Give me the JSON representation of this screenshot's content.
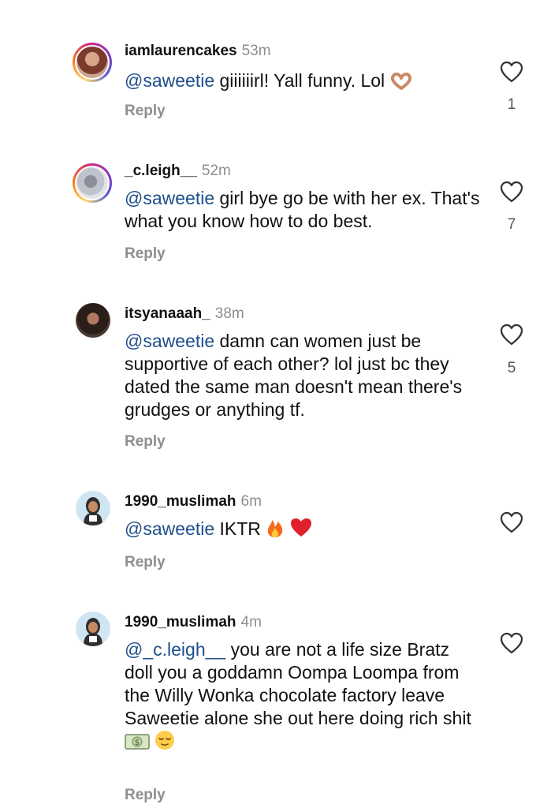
{
  "comments": [
    {
      "username": "iamlaurencakes",
      "time": "53m",
      "mention": "@saweetie",
      "text": "giiiiiirl! Yall funny. Lol",
      "emoji": [
        "heart-hands-emoji"
      ],
      "reply_label": "Reply",
      "likes": "1",
      "avatar": "photo-avatar"
    },
    {
      "username": "_c.leigh__",
      "time": "52m",
      "mention": "@saweetie",
      "text": "girl bye go be with her ex. That's what you know how to do best.",
      "emoji": [],
      "reply_label": "Reply",
      "likes": "7",
      "avatar": "photo-avatar"
    },
    {
      "username": "itsyanaaah_",
      "time": "38m",
      "mention": "@saweetie",
      "text": "damn can women just be supportive of each other? lol just bc they dated the same man doesn't mean there's grudges or anything tf.",
      "emoji": [],
      "reply_label": "Reply",
      "likes": "5",
      "avatar": "photo-avatar"
    },
    {
      "username": "1990_muslimah",
      "time": "6m",
      "mention": "@saweetie",
      "text": "IKTR",
      "emoji": [
        "fire-emoji",
        "red-heart-emoji"
      ],
      "reply_label": "Reply",
      "likes": "",
      "avatar": "bitmoji-avatar"
    },
    {
      "username": "1990_muslimah",
      "time": "4m",
      "mention": "@_c.leigh__",
      "text": "you are not a life size Bratz doll you a goddamn Oompa Loompa from the Willy Wonka chocolate factory leave Saweetie alone she out here doing rich shit",
      "emoji": [
        "money-emoji",
        "relieved-face-emoji"
      ],
      "reply_label": "Reply",
      "likes": "",
      "avatar": "bitmoji-avatar"
    }
  ],
  "icons": {
    "like": "heart-outline-icon"
  },
  "colors": {
    "mention": "#1f4f8a",
    "secondary_text": "#8e8e8e",
    "story_ring": "#d62976"
  }
}
